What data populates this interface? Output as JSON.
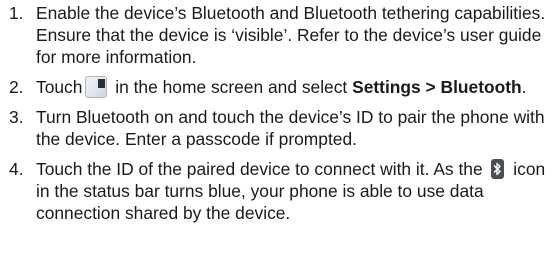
{
  "steps": [
    {
      "number": "1.",
      "text": "Enable the device’s Bluetooth and Bluetooth tethering capabilities. Ensure that the device is ‘visible’. Refer to the device’s user guide for more information."
    },
    {
      "number": "2.",
      "before_icon": "Touch",
      "icon": "apps-grid-icon",
      "after_icon": " in the home screen and select ",
      "bold": "Settings > Bluetooth",
      "end": "."
    },
    {
      "number": "3.",
      "text": "Turn Bluetooth on and touch the device’s ID to pair the phone with the device. Enter a passcode if prompted."
    },
    {
      "number": "4.",
      "before_icon": "Touch the ID of the paired device to connect with it. As the",
      "icon": "bluetooth-icon",
      "after_icon": " icon in the status bar turns blue, your phone is able to use data connection shared by the device."
    }
  ]
}
